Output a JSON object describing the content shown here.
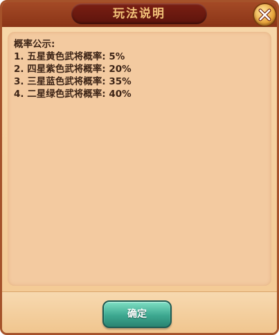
{
  "dialog": {
    "title": "玩法说明",
    "close_icon": "close-x-icon",
    "content_lines": [
      "概率公示:",
      "1. 五星黄色武将概率: 5%",
      "2. 四星紫色武将概率: 20%",
      "3. 三星蓝色武将概率: 35%",
      "4. 二星绿色武将概率: 40%"
    ],
    "confirm_label": "确定"
  },
  "colors": {
    "title_bar": "#8a3417",
    "title_text": "#f2c279",
    "panel": "#f3caa0",
    "body_text": "#3d2416",
    "confirm_button": "#3da890"
  }
}
